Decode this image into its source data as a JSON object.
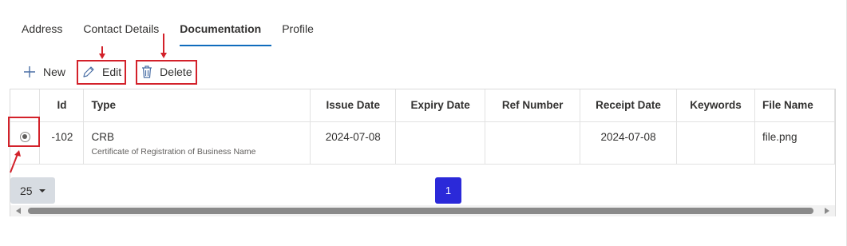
{
  "tabs": [
    {
      "label": "Address",
      "active": false
    },
    {
      "label": "Contact Details",
      "active": false
    },
    {
      "label": "Documentation",
      "active": true
    },
    {
      "label": "Profile",
      "active": false
    }
  ],
  "toolbar": {
    "new_label": "New",
    "edit_label": "Edit",
    "delete_label": "Delete"
  },
  "grid": {
    "columns": [
      "",
      "Id",
      "Type",
      "Issue Date",
      "Expiry Date",
      "Ref Number",
      "Receipt Date",
      "Keywords",
      "File Name"
    ],
    "rows": [
      {
        "selected": true,
        "id": "-102",
        "type": "CRB",
        "type_description": "Certificate of Registration of Business Name",
        "issue_date": "2024-07-08",
        "expiry_date": "",
        "ref_number": "",
        "receipt_date": "2024-07-08",
        "keywords": "",
        "file_name": "file.png"
      }
    ]
  },
  "pager": {
    "page_size": "25",
    "current_page": "1"
  },
  "colors": {
    "accent": "#0f6cbd",
    "annotation_red": "#d3212a",
    "page_button": "#2b29d9"
  }
}
